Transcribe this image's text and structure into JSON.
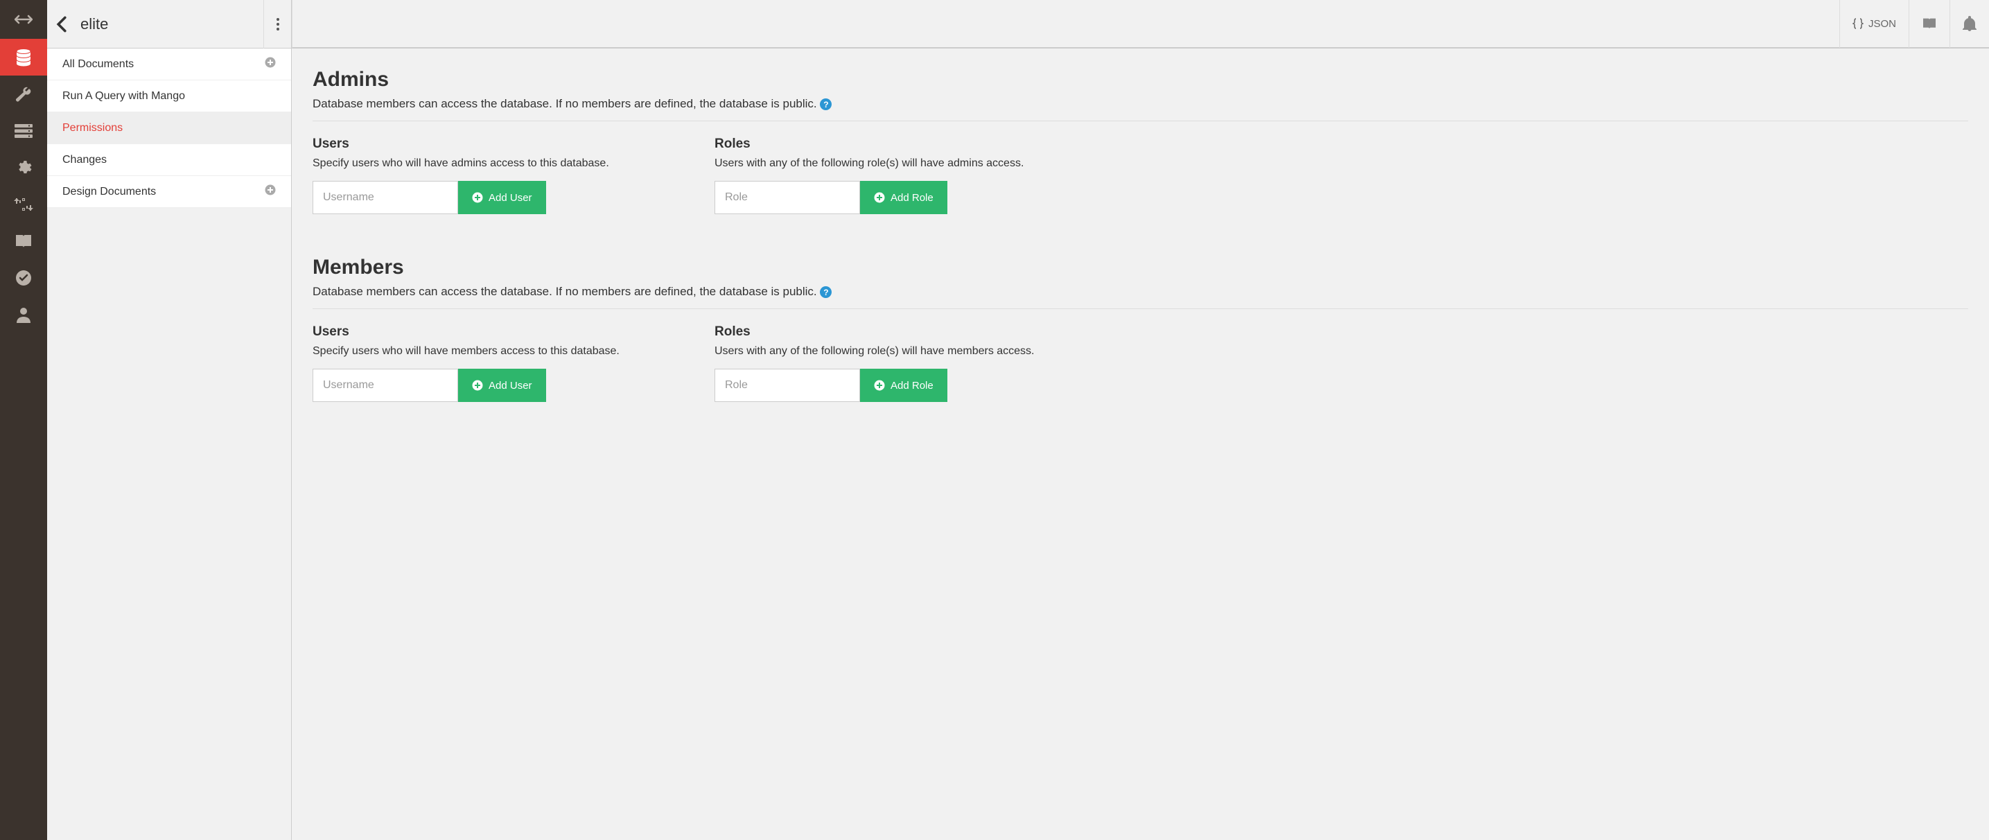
{
  "database_name": "elite",
  "sidebar": {
    "items": [
      {
        "label": "All Documents",
        "has_add": true,
        "active": false
      },
      {
        "label": "Run A Query with Mango",
        "has_add": false,
        "active": false
      },
      {
        "label": "Permissions",
        "has_add": false,
        "active": true
      },
      {
        "label": "Changes",
        "has_add": false,
        "active": false
      },
      {
        "label": "Design Documents",
        "has_add": true,
        "active": false
      }
    ]
  },
  "topbar": {
    "json_label": "JSON"
  },
  "sections": {
    "admins": {
      "title": "Admins",
      "description": "Database members can access the database. If no members are defined, the database is public.",
      "users": {
        "heading": "Users",
        "sub": "Specify users who will have admins access to this database.",
        "placeholder": "Username",
        "button": "Add User"
      },
      "roles": {
        "heading": "Roles",
        "sub": "Users with any of the following role(s) will have admins access.",
        "placeholder": "Role",
        "button": "Add Role"
      }
    },
    "members": {
      "title": "Members",
      "description": "Database members can access the database. If no members are defined, the database is public.",
      "users": {
        "heading": "Users",
        "sub": "Specify users who will have members access to this database.",
        "placeholder": "Username",
        "button": "Add User"
      },
      "roles": {
        "heading": "Roles",
        "sub": "Users with any of the following role(s) will have members access.",
        "placeholder": "Role",
        "button": "Add Role"
      }
    }
  }
}
